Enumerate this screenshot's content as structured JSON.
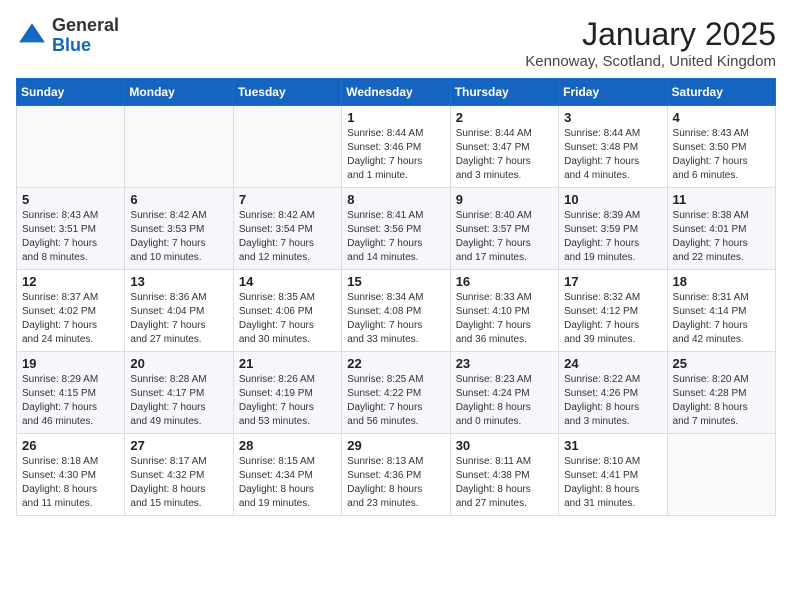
{
  "header": {
    "logo_general": "General",
    "logo_blue": "Blue",
    "month_title": "January 2025",
    "location": "Kennoway, Scotland, United Kingdom"
  },
  "days_of_week": [
    "Sunday",
    "Monday",
    "Tuesday",
    "Wednesday",
    "Thursday",
    "Friday",
    "Saturday"
  ],
  "weeks": [
    [
      {
        "day": "",
        "info": ""
      },
      {
        "day": "",
        "info": ""
      },
      {
        "day": "",
        "info": ""
      },
      {
        "day": "1",
        "info": "Sunrise: 8:44 AM\nSunset: 3:46 PM\nDaylight: 7 hours\nand 1 minute."
      },
      {
        "day": "2",
        "info": "Sunrise: 8:44 AM\nSunset: 3:47 PM\nDaylight: 7 hours\nand 3 minutes."
      },
      {
        "day": "3",
        "info": "Sunrise: 8:44 AM\nSunset: 3:48 PM\nDaylight: 7 hours\nand 4 minutes."
      },
      {
        "day": "4",
        "info": "Sunrise: 8:43 AM\nSunset: 3:50 PM\nDaylight: 7 hours\nand 6 minutes."
      }
    ],
    [
      {
        "day": "5",
        "info": "Sunrise: 8:43 AM\nSunset: 3:51 PM\nDaylight: 7 hours\nand 8 minutes."
      },
      {
        "day": "6",
        "info": "Sunrise: 8:42 AM\nSunset: 3:53 PM\nDaylight: 7 hours\nand 10 minutes."
      },
      {
        "day": "7",
        "info": "Sunrise: 8:42 AM\nSunset: 3:54 PM\nDaylight: 7 hours\nand 12 minutes."
      },
      {
        "day": "8",
        "info": "Sunrise: 8:41 AM\nSunset: 3:56 PM\nDaylight: 7 hours\nand 14 minutes."
      },
      {
        "day": "9",
        "info": "Sunrise: 8:40 AM\nSunset: 3:57 PM\nDaylight: 7 hours\nand 17 minutes."
      },
      {
        "day": "10",
        "info": "Sunrise: 8:39 AM\nSunset: 3:59 PM\nDaylight: 7 hours\nand 19 minutes."
      },
      {
        "day": "11",
        "info": "Sunrise: 8:38 AM\nSunset: 4:01 PM\nDaylight: 7 hours\nand 22 minutes."
      }
    ],
    [
      {
        "day": "12",
        "info": "Sunrise: 8:37 AM\nSunset: 4:02 PM\nDaylight: 7 hours\nand 24 minutes."
      },
      {
        "day": "13",
        "info": "Sunrise: 8:36 AM\nSunset: 4:04 PM\nDaylight: 7 hours\nand 27 minutes."
      },
      {
        "day": "14",
        "info": "Sunrise: 8:35 AM\nSunset: 4:06 PM\nDaylight: 7 hours\nand 30 minutes."
      },
      {
        "day": "15",
        "info": "Sunrise: 8:34 AM\nSunset: 4:08 PM\nDaylight: 7 hours\nand 33 minutes."
      },
      {
        "day": "16",
        "info": "Sunrise: 8:33 AM\nSunset: 4:10 PM\nDaylight: 7 hours\nand 36 minutes."
      },
      {
        "day": "17",
        "info": "Sunrise: 8:32 AM\nSunset: 4:12 PM\nDaylight: 7 hours\nand 39 minutes."
      },
      {
        "day": "18",
        "info": "Sunrise: 8:31 AM\nSunset: 4:14 PM\nDaylight: 7 hours\nand 42 minutes."
      }
    ],
    [
      {
        "day": "19",
        "info": "Sunrise: 8:29 AM\nSunset: 4:15 PM\nDaylight: 7 hours\nand 46 minutes."
      },
      {
        "day": "20",
        "info": "Sunrise: 8:28 AM\nSunset: 4:17 PM\nDaylight: 7 hours\nand 49 minutes."
      },
      {
        "day": "21",
        "info": "Sunrise: 8:26 AM\nSunset: 4:19 PM\nDaylight: 7 hours\nand 53 minutes."
      },
      {
        "day": "22",
        "info": "Sunrise: 8:25 AM\nSunset: 4:22 PM\nDaylight: 7 hours\nand 56 minutes."
      },
      {
        "day": "23",
        "info": "Sunrise: 8:23 AM\nSunset: 4:24 PM\nDaylight: 8 hours\nand 0 minutes."
      },
      {
        "day": "24",
        "info": "Sunrise: 8:22 AM\nSunset: 4:26 PM\nDaylight: 8 hours\nand 3 minutes."
      },
      {
        "day": "25",
        "info": "Sunrise: 8:20 AM\nSunset: 4:28 PM\nDaylight: 8 hours\nand 7 minutes."
      }
    ],
    [
      {
        "day": "26",
        "info": "Sunrise: 8:18 AM\nSunset: 4:30 PM\nDaylight: 8 hours\nand 11 minutes."
      },
      {
        "day": "27",
        "info": "Sunrise: 8:17 AM\nSunset: 4:32 PM\nDaylight: 8 hours\nand 15 minutes."
      },
      {
        "day": "28",
        "info": "Sunrise: 8:15 AM\nSunset: 4:34 PM\nDaylight: 8 hours\nand 19 minutes."
      },
      {
        "day": "29",
        "info": "Sunrise: 8:13 AM\nSunset: 4:36 PM\nDaylight: 8 hours\nand 23 minutes."
      },
      {
        "day": "30",
        "info": "Sunrise: 8:11 AM\nSunset: 4:38 PM\nDaylight: 8 hours\nand 27 minutes."
      },
      {
        "day": "31",
        "info": "Sunrise: 8:10 AM\nSunset: 4:41 PM\nDaylight: 8 hours\nand 31 minutes."
      },
      {
        "day": "",
        "info": ""
      }
    ]
  ]
}
